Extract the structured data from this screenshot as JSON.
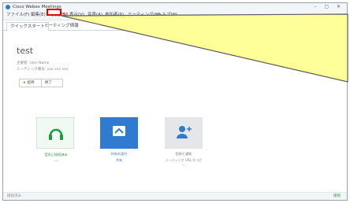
{
  "window": {
    "title": "Cisco Webex Meetings"
  },
  "menu": {
    "items": [
      "ファイル(F)",
      "編集(E)",
      "共有(S)",
      "表示(V)",
      "音声(A)",
      "参加者(P)",
      "ミーティング(M)",
      "ヘルプ(H)"
    ]
  },
  "tabs": [
    "クイックスタート",
    "ミーティング情報"
  ],
  "meeting": {
    "title": "test",
    "host_line": "主催者:  User Name",
    "number_line": "ミーティング番号:  xxx xxx xxx"
  },
  "buttons": {
    "invite": "招待",
    "remind": "終了"
  },
  "tiles": [
    {
      "label": "音声に接続済み",
      "sub": "-----",
      "icon": "headset-icon",
      "color": "#1a9e3a"
    },
    {
      "label": "共有の実行",
      "sub": "共有",
      "icon": "share-icon",
      "color": "#2e7bd1"
    },
    {
      "label": "招待と通知",
      "sub": "ミーティング URL をコピー",
      "icon": "add-user-icon",
      "color": "#2e7bd1"
    }
  ],
  "status": {
    "left": "接続済み",
    "right": "接続"
  },
  "colors": {
    "highlight": "#e00000",
    "callout": "#ffff99",
    "accent": "#2e7bd1"
  }
}
